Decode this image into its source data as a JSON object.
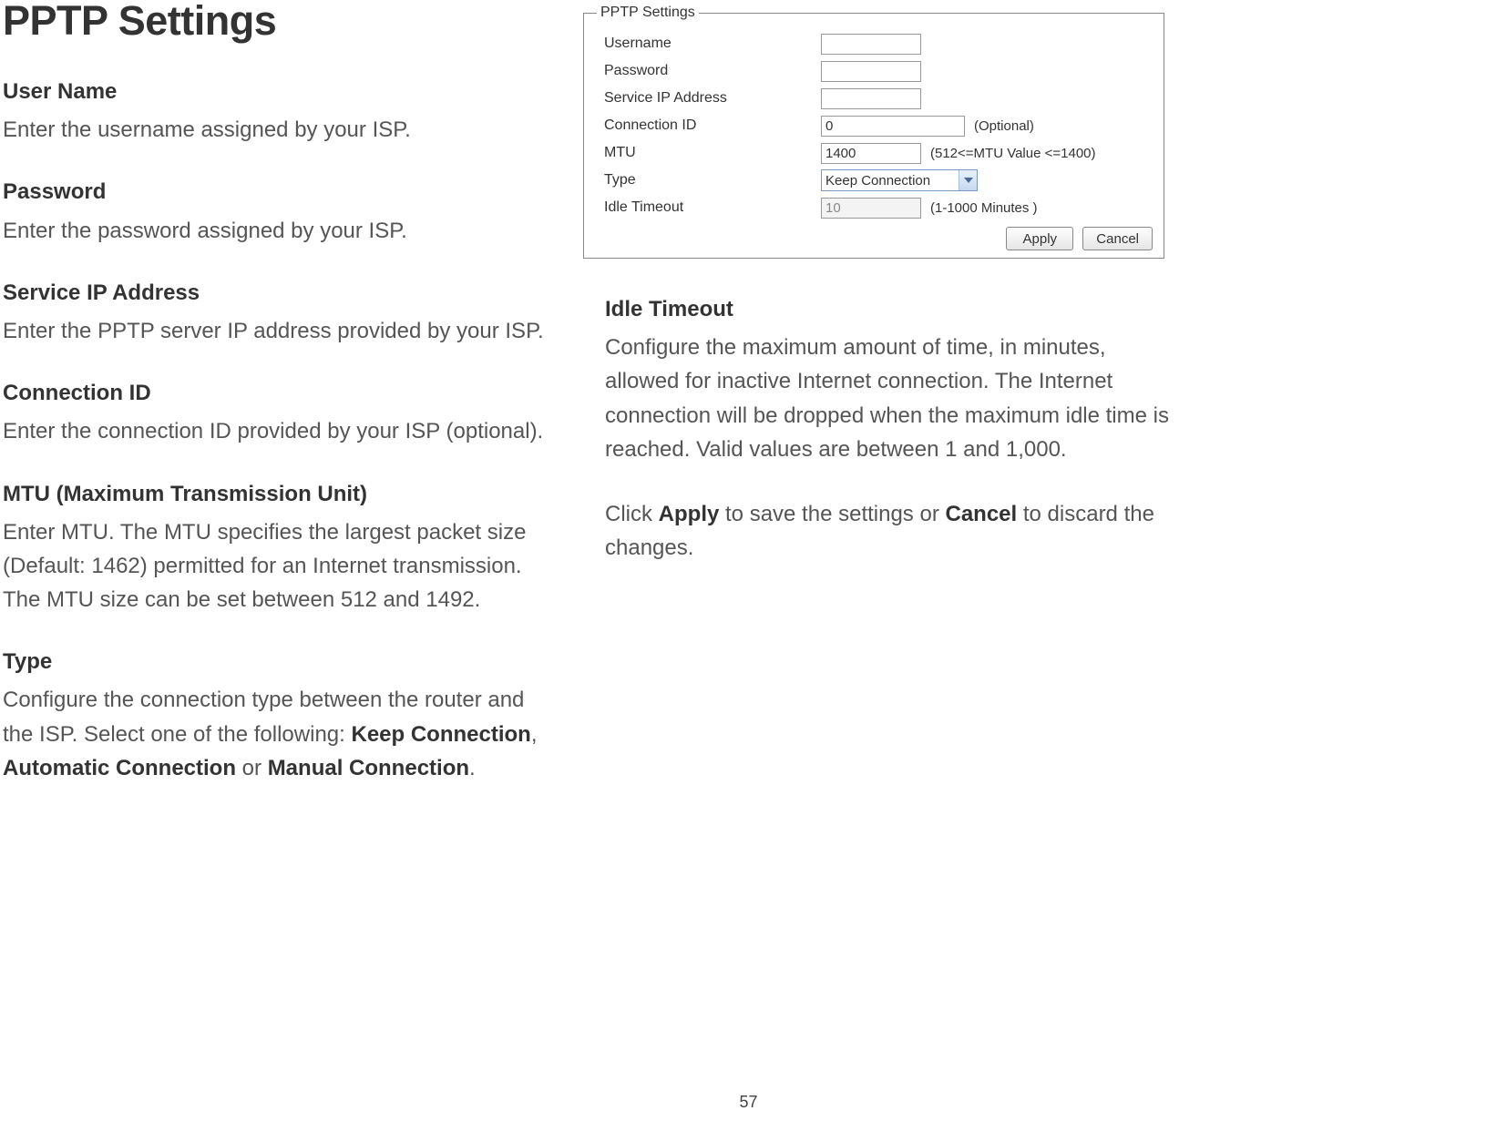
{
  "page": {
    "title": "PPTP Settings",
    "number": "57"
  },
  "left": {
    "username": {
      "title": "User Name",
      "body": "Enter the username assigned by your ISP."
    },
    "password": {
      "title": "Password",
      "body": "Enter the password assigned by your ISP."
    },
    "serviceip": {
      "title": "Service IP Address",
      "body": "Enter the PPTP server IP address provided by your ISP."
    },
    "connid": {
      "title": "Connection ID",
      "body": "Enter the connection ID provided by your ISP (optional)."
    },
    "mtu": {
      "title": "MTU (Maximum Transmission Unit)",
      "body": "Enter MTU. The MTU specifies the largest packet size (Default: 1462) permitted for an Internet transmission. The MTU size can be set between 512 and 1492."
    },
    "type": {
      "title": "Type",
      "body_prefix": "Configure the connection type between the router and the ISP. Select one of the following: ",
      "opt1": "Keep Connection",
      "sep1": ", ",
      "opt2": "Automatic Connection",
      "sep2": " or ",
      "opt3": "Manual Connection",
      "suffix": "."
    }
  },
  "right": {
    "idle": {
      "title": "Idle Timeout",
      "body": "Configure the maximum amount of time, in minutes, allowed for inactive Internet connection. The Internet connection will be dropped when the maximum idle time is reached. Valid values are between 1 and 1,000."
    },
    "final": {
      "t1": "Click ",
      "b1": "Apply",
      "t2": " to save the settings or ",
      "b2": "Cancel",
      "t3": " to discard the changes."
    }
  },
  "form": {
    "legend": "PPTP Settings",
    "username": {
      "label": "Username",
      "value": ""
    },
    "password": {
      "label": "Password",
      "value": ""
    },
    "serviceip": {
      "label": "Service IP Address",
      "value": ""
    },
    "connid": {
      "label": "Connection ID",
      "value": "0",
      "hint": "(Optional)"
    },
    "mtu": {
      "label": "MTU",
      "value": "1400",
      "hint": "(512<=MTU Value <=1400)"
    },
    "type": {
      "label": "Type",
      "selected": "Keep Connection"
    },
    "idle": {
      "label": "Idle Timeout",
      "value": "10",
      "hint": "(1-1000 Minutes )"
    },
    "buttons": {
      "apply": "Apply",
      "cancel": "Cancel"
    }
  }
}
